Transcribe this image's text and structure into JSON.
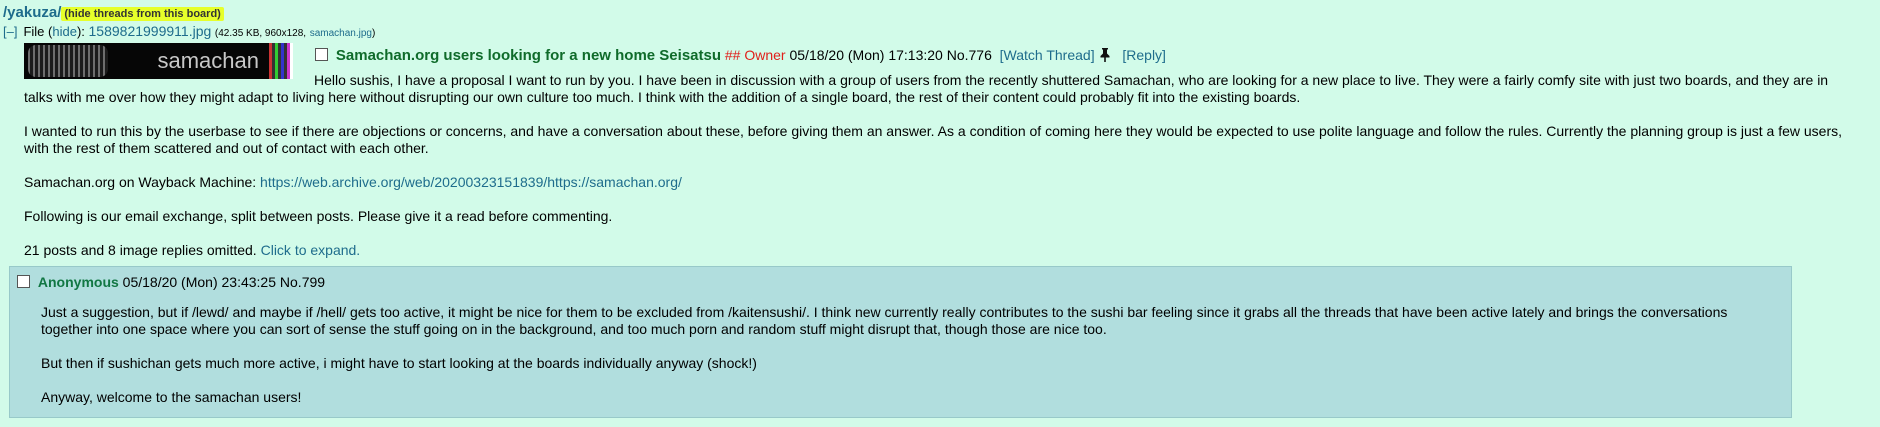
{
  "board": {
    "path": "/yakuza/",
    "hide_threads": "(hide threads from this board)"
  },
  "file": {
    "toggle": "[–]",
    "label": "File (",
    "hide": "hide",
    "label_close": "):",
    "filename": "1589821999911.jpg",
    "info": "(42.35 KB, 960x128,",
    "original_name": "samachan.jpg",
    "info_close": ")",
    "thumb_text": "samachan"
  },
  "op": {
    "subject": "Samachan.org users looking for a new home Seisatsu",
    "capcode": "## Owner",
    "datetime": "05/18/20 (Mon) 17:13:20",
    "no_label": "No.",
    "no": "776",
    "watch": "[Watch Thread]",
    "reply": "[Reply]",
    "paragraphs": [
      "Hello sushis, I have a proposal I want to run by you. I have been in discussion with a group of users from the recently shuttered Samachan, who are looking for a new place to live. They were a fairly comfy site with just two boards, and they are in talks with me over how they might adapt to living here without disrupting our own culture too much. I think with the addition of a single board, the rest of their content could probably fit into the existing boards.",
      "I wanted to run this by the userbase to see if there are objections or concerns, and have a conversation about these, before giving them an answer. As a condition of coming here they would be expected to use polite language and follow the rules. Currently the planning group is just a few users, with the rest of them scattered and out of contact with each other."
    ],
    "wayback_label": "Samachan.org on Wayback Machine:",
    "wayback_url": "https://web.archive.org/web/20200323151839/https://samachan.org/",
    "following": "Following is our email exchange, split between posts. Please give it a read before commenting.",
    "omitted": "21 posts and 8 image replies omitted.",
    "expand": "Click to expand."
  },
  "reply": {
    "name": "Anonymous",
    "datetime": "05/18/20 (Mon) 23:43:25",
    "no_label": "No.",
    "no": "799",
    "paragraphs": [
      "Just a suggestion, but if /lewd/ and maybe if /hell/ gets too active, it might be nice for them to be excluded from /kaitensushi/. I think new currently really contributes to the sushi bar feeling since it grabs all the threads that have been active lately and brings the conversations together into one space where you can sort of sense the stuff going on in the background, and too much porn and random stuff might disrupt that, though those are nice too.",
      "But then if sushichan gets much more active, i might have to start looking at the boards individually anyway (shock!)",
      "Anyway, welcome to the samachan users!"
    ]
  },
  "icons": {
    "pin": "pin-icon"
  }
}
